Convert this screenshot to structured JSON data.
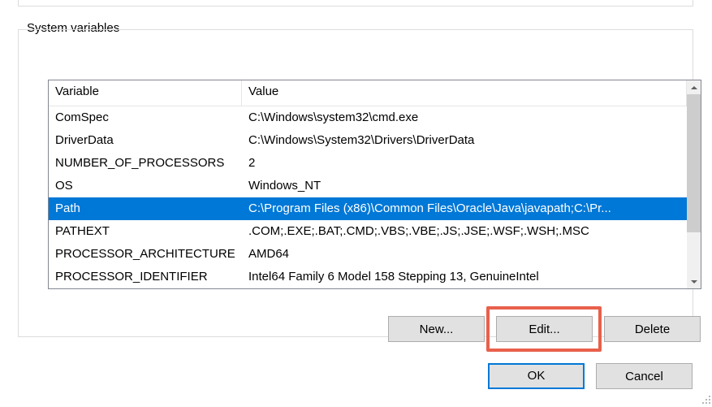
{
  "group": {
    "label": "System variables",
    "headers": {
      "variable": "Variable",
      "value": "Value"
    },
    "rows": [
      {
        "variable": "ComSpec",
        "value": "C:\\Windows\\system32\\cmd.exe",
        "selected": false
      },
      {
        "variable": "DriverData",
        "value": "C:\\Windows\\System32\\Drivers\\DriverData",
        "selected": false
      },
      {
        "variable": "NUMBER_OF_PROCESSORS",
        "value": "2",
        "selected": false
      },
      {
        "variable": "OS",
        "value": "Windows_NT",
        "selected": false
      },
      {
        "variable": "Path",
        "value": "C:\\Program Files (x86)\\Common Files\\Oracle\\Java\\javapath;C:\\Pr...",
        "selected": true
      },
      {
        "variable": "PATHEXT",
        "value": ".COM;.EXE;.BAT;.CMD;.VBS;.VBE;.JS;.JSE;.WSF;.WSH;.MSC",
        "selected": false
      },
      {
        "variable": "PROCESSOR_ARCHITECTURE",
        "value": "AMD64",
        "selected": false
      },
      {
        "variable": "PROCESSOR_IDENTIFIER",
        "value": "Intel64 Family 6 Model 158 Stepping 13, GenuineIntel",
        "selected": false
      }
    ],
    "buttons": {
      "new": "New...",
      "edit": "Edit...",
      "delete": "Delete"
    }
  },
  "dialog": {
    "ok": "OK",
    "cancel": "Cancel"
  }
}
